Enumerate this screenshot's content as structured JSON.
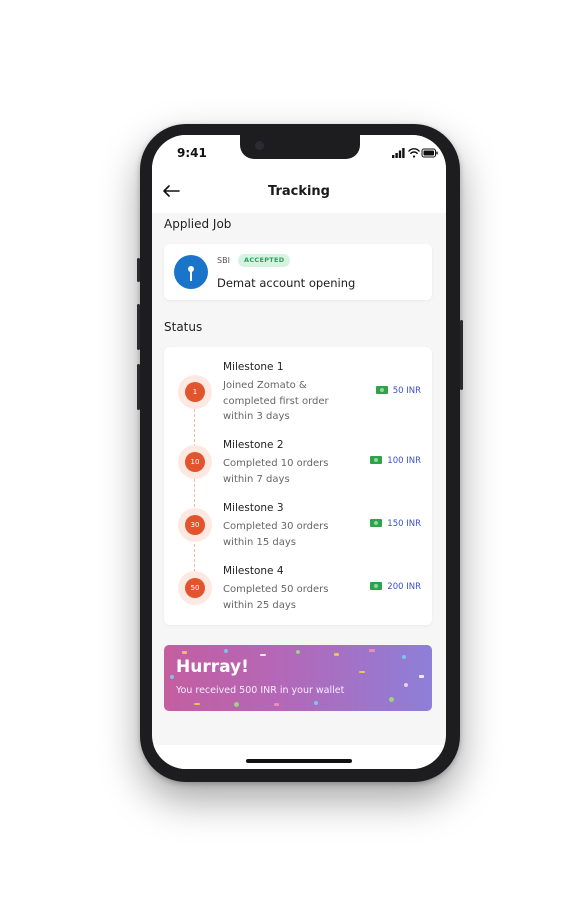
{
  "status_bar": {
    "time": "9:41"
  },
  "header": {
    "title": "Tracking"
  },
  "applied_job": {
    "section_label": "Applied Job",
    "company": "SBI",
    "status_badge": "ACCEPTED",
    "job_title": "Demat account opening"
  },
  "status": {
    "section_label": "Status",
    "milestones": [
      {
        "badge": "1",
        "title": "Milestone 1",
        "description": "Joined Zomato & completed first order within 3 days",
        "reward": "50 INR"
      },
      {
        "badge": "10",
        "title": "Milestone 2",
        "description": "Completed 10 orders within 7 days",
        "reward": "100 INR"
      },
      {
        "badge": "30",
        "title": "Milestone 3",
        "description": "Completed 30 orders within 15 days",
        "reward": "150 INR"
      },
      {
        "badge": "50",
        "title": "Milestone 4",
        "description": "Completed 50 orders within 25 days",
        "reward": "200 INR"
      }
    ]
  },
  "banner": {
    "title": "Hurray!",
    "subtitle": "You received 500 INR in your wallet"
  },
  "colors": {
    "accent_orange": "#e2542d",
    "reward_blue": "#3b4fcb",
    "accepted_green": "#2aa05a",
    "sbi_blue": "#1a74c9"
  }
}
